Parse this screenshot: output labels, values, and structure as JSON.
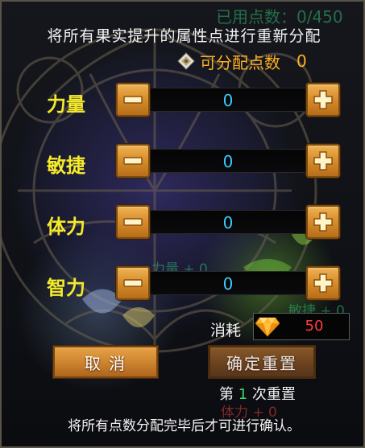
{
  "instruction": "将所有果实提升的属性点进行重新分配",
  "background_text": {
    "used_points": "已用点数：0/450",
    "strength": "力量 + 0",
    "agility": "敏捷 + 0",
    "stamina": "体力 + 0"
  },
  "available_points": {
    "label": "可分配点数",
    "value": "0"
  },
  "stats": [
    {
      "label": "力量",
      "value": "0"
    },
    {
      "label": "敏捷",
      "value": "0"
    },
    {
      "label": "体力",
      "value": "0"
    },
    {
      "label": "智力",
      "value": "0"
    }
  ],
  "cost": {
    "label": "消耗",
    "value": "50",
    "currency_icon": "diamond-gem-icon"
  },
  "buttons": {
    "cancel": "取 消",
    "confirm": "确定重置"
  },
  "reset_info": {
    "prefix": "第",
    "count": "1",
    "suffix": "次重置"
  },
  "footer_note": "将所有点数分配完毕后才可进行确认。",
  "colors": {
    "label_yellow": "#f5ea2a",
    "value_blue": "#3ec8ff",
    "orange": "#ffb020",
    "cost_red": "#ff3b3b",
    "count_green": "#3ad96a"
  }
}
